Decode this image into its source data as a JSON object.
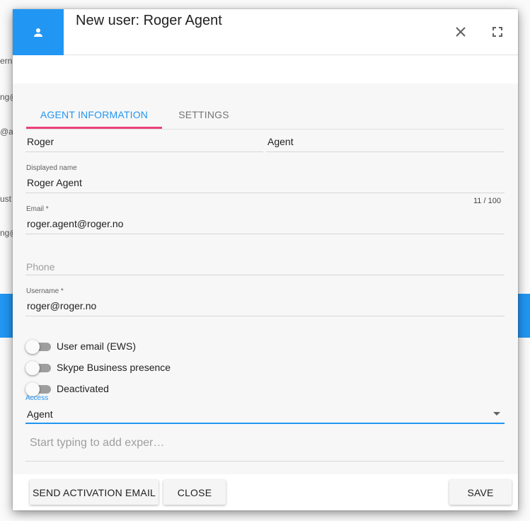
{
  "background": {
    "fragments": [
      "erna",
      "ng@",
      "@a",
      "ust",
      "ng@"
    ],
    "accent": "#2196f3"
  },
  "dialog": {
    "header": {
      "icon": "person-icon",
      "title": "New user: Roger Agent",
      "close_icon": "close-icon",
      "fullscreen_icon": "fullscreen-icon"
    },
    "tabs": [
      {
        "label": "AGENT INFORMATION",
        "active": true
      },
      {
        "label": "SETTINGS",
        "active": false
      }
    ],
    "form": {
      "first_name": {
        "value": "Roger"
      },
      "last_name": {
        "value": "Agent"
      },
      "displayed_name": {
        "label": "Displayed name",
        "value": "Roger Agent",
        "counter": "11 / 100"
      },
      "email": {
        "label": "Email *",
        "value": "roger.agent@roger.no"
      },
      "phone": {
        "placeholder": "Phone",
        "value": ""
      },
      "username": {
        "label": "Username *",
        "value": "roger@roger.no"
      },
      "toggles": [
        {
          "label": "User email (EWS)",
          "on": false
        },
        {
          "label": "Skype Business presence",
          "on": false
        },
        {
          "label": "Deactivated",
          "on": false
        }
      ],
      "access": {
        "label": "Access",
        "value": "Agent"
      },
      "expertise": {
        "placeholder": "Start typing to add exper…"
      }
    },
    "footer": {
      "send_activation_label": "SEND ACTIVATION EMAIL",
      "close_label": "CLOSE",
      "save_label": "SAVE"
    }
  },
  "colors": {
    "primary": "#2196f3",
    "tab_indicator": "#ec407a"
  }
}
